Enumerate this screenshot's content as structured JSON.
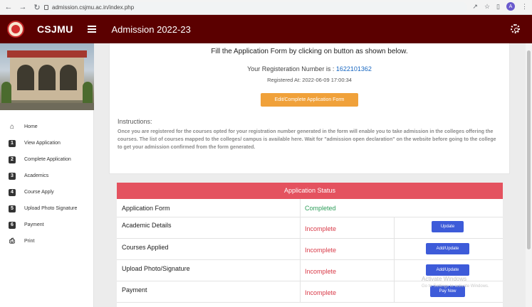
{
  "browser": {
    "url": "admission.csjmu.ac.in/index.php",
    "profile_initial": "A"
  },
  "header": {
    "brand": "CSJMU",
    "title": "Admission 2022-23",
    "accent_color": "#5b0000"
  },
  "sidebar": {
    "items": [
      {
        "label": "Home",
        "icon": "home-icon"
      },
      {
        "label": "View Application",
        "icon": "1"
      },
      {
        "label": "Complete Application",
        "icon": "2"
      },
      {
        "label": "Academics",
        "icon": "3"
      },
      {
        "label": "Course Apply",
        "icon": "4"
      },
      {
        "label": "Upload Photo Signature",
        "icon": "5"
      },
      {
        "label": "Payment",
        "icon": "6"
      },
      {
        "label": "Print",
        "icon": "print-icon"
      }
    ]
  },
  "main": {
    "heading": "Fill the Application Form by clicking on button as shown below.",
    "reg_label": "Your Registeration Number is : ",
    "reg_number": "1622101362",
    "reg_at": "Registered At: 2022-06-09 17:00:34",
    "edit_button": "Edit/Complete Application Form",
    "instructions_title": "Instructions:",
    "instructions_text": "Once you are registered for the courses opted for your registration number generated in the form will enable you to take admission in the colleges offering the courses. The list of courses mapped to the colleges/ campus is available here. Wait for \"admission open declaration\" on the website before going to the college to get your admission confirmed from the form generated."
  },
  "status": {
    "heading": "Application Status",
    "rows": [
      {
        "label": "Application Form",
        "status": "Completed",
        "button": ""
      },
      {
        "label": "Academic Details",
        "status": "Incomplete",
        "button": "Update"
      },
      {
        "label": "Courses Applied",
        "status": "Incomplete",
        "button": "Add/Update"
      },
      {
        "label": "Upload Photo/Signature",
        "status": "Incomplete",
        "button": "Add/Update"
      },
      {
        "label": "Payment",
        "status": "Incomplete",
        "button": "Pay Now"
      }
    ]
  },
  "watermark": {
    "line1": "Activate Windows",
    "line2": "Go to Settings to activate Windows."
  }
}
